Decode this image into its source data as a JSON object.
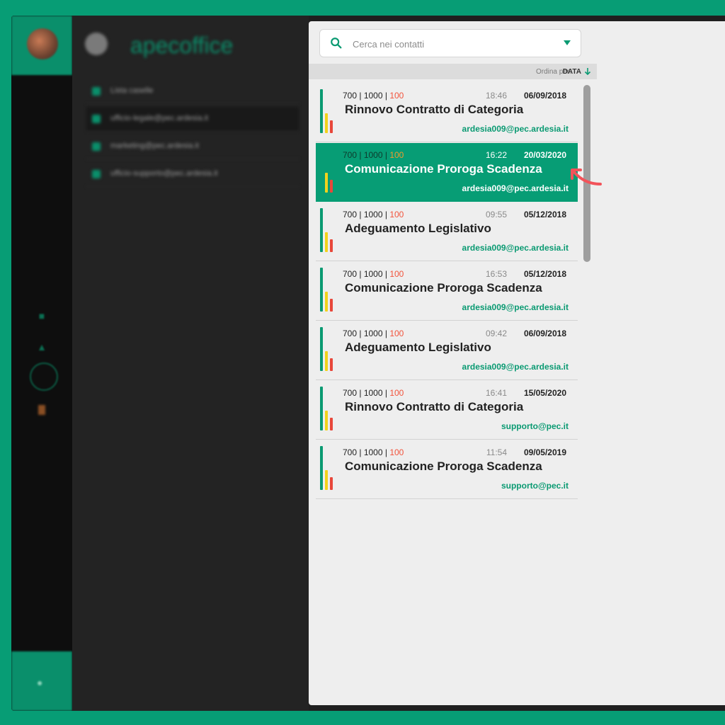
{
  "app": {
    "logo_text": "apecoffice"
  },
  "accounts": [
    {
      "label": "Lista caselle"
    },
    {
      "label": "ufficio-legale@pec.ardesia.it"
    },
    {
      "label": "marketing@pec.ardesia.it"
    },
    {
      "label": "ufficio-supporto@pec.ardesia.it"
    }
  ],
  "search": {
    "placeholder": "Cerca nei contatti"
  },
  "sort": {
    "label": "Ordina per:",
    "value": "DATA"
  },
  "messages": [
    {
      "c1": "700",
      "c2": "1000",
      "c3": "100",
      "time": "18:46",
      "date": "06/09/2018",
      "subject": "Rinnovo Contratto di Categoria",
      "sender": "ardesia009@pec.ardesia.it"
    },
    {
      "c1": "700",
      "c2": "1000",
      "c3": "100",
      "time": "16:22",
      "date": "20/03/2020",
      "subject": "Comunicazione Proroga Scadenza",
      "sender": "ardesia009@pec.ardesia.it"
    },
    {
      "c1": "700",
      "c2": "1000",
      "c3": "100",
      "time": "09:55",
      "date": "05/12/2018",
      "subject": "Adeguamento Legislativo",
      "sender": "ardesia009@pec.ardesia.it"
    },
    {
      "c1": "700",
      "c2": "1000",
      "c3": "100",
      "time": "16:53",
      "date": "05/12/2018",
      "subject": "Comunicazione Proroga Scadenza",
      "sender": "ardesia009@pec.ardesia.it"
    },
    {
      "c1": "700",
      "c2": "1000",
      "c3": "100",
      "time": "09:42",
      "date": "06/09/2018",
      "subject": "Adeguamento Legislativo",
      "sender": "ardesia009@pec.ardesia.it"
    },
    {
      "c1": "700",
      "c2": "1000",
      "c3": "100",
      "time": "16:41",
      "date": "15/05/2020",
      "subject": "Rinnovo Contratto di Categoria",
      "sender": "supporto@pec.it"
    },
    {
      "c1": "700",
      "c2": "1000",
      "c3": "100",
      "time": "11:54",
      "date": "09/05/2019",
      "subject": "Comunicazione Proroga Scadenza",
      "sender": "supporto@pec.it"
    }
  ],
  "selected_index": 1,
  "colors": {
    "accent": "#079d75",
    "highlight_number": "#f2533b",
    "bar_green": "#0a9a72",
    "bar_yellow": "#f2d21c",
    "bar_red": "#e8473a",
    "pointer": "#f2535a"
  },
  "icons": {
    "search": "search-icon",
    "dropdown": "chevron-down-icon",
    "sort": "arrow-down-icon",
    "pointer": "curved-arrow-icon"
  }
}
